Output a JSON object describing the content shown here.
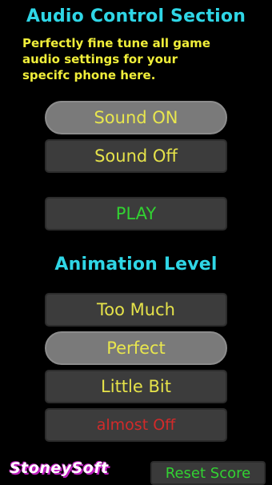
{
  "audio": {
    "heading": "Audio Control Section",
    "description_lines": [
      "Perfectly fine tune all game",
      "audio settings for your",
      "specifc phone here."
    ],
    "sound_on_label": "Sound ON",
    "sound_off_label": "Sound Off",
    "play_label": "PLAY",
    "selected": "Sound ON"
  },
  "animation": {
    "heading": "Animation Level",
    "options": [
      "Too Much",
      "Perfect",
      "Little Bit",
      "almost Off"
    ],
    "selected": "Perfect"
  },
  "footer": {
    "logo_text": "StoneySoft",
    "reset_label": "Reset Score"
  },
  "colors": {
    "background": "#000000",
    "heading": "#2fd6e6",
    "description": "#f0ee3a",
    "button_text": "#e5e24a",
    "play_text": "#32d232",
    "warning_text": "#d22a2a",
    "selected_button": "#7a7a7a",
    "button": "#3c3c3c",
    "logo_shadow": "#c020c0"
  }
}
